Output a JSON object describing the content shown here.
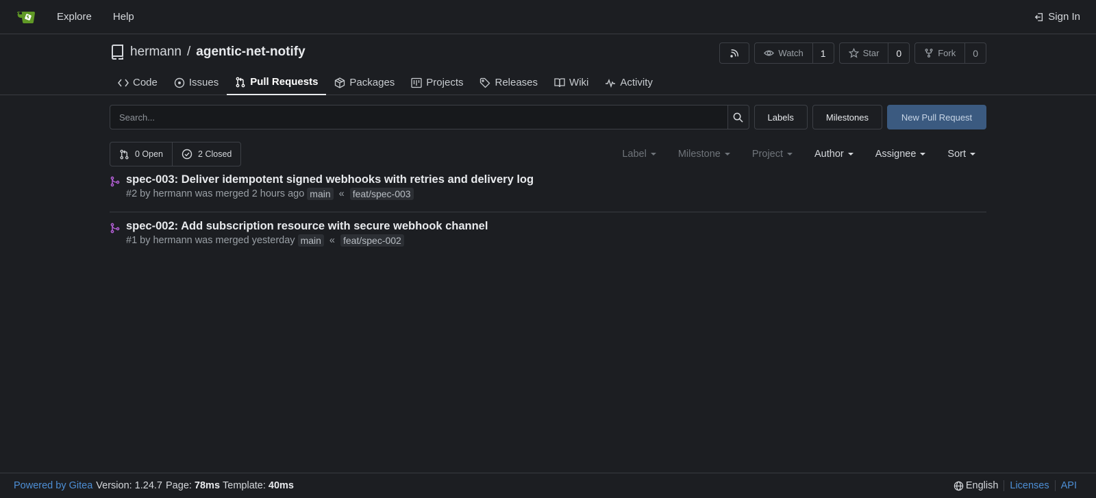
{
  "navbar": {
    "explore": "Explore",
    "help": "Help",
    "sign_in": "Sign In"
  },
  "repo": {
    "owner": "hermann",
    "separator": "/",
    "name": "agentic-net-notify",
    "watch_label": "Watch",
    "watch_count": "1",
    "star_label": "Star",
    "star_count": "0",
    "fork_label": "Fork",
    "fork_count": "0"
  },
  "tabs": [
    {
      "label": "Code",
      "icon": "code-icon"
    },
    {
      "label": "Issues",
      "icon": "issue-icon"
    },
    {
      "label": "Pull Requests",
      "icon": "pull-request-icon",
      "active": true
    },
    {
      "label": "Packages",
      "icon": "package-icon"
    },
    {
      "label": "Projects",
      "icon": "project-icon"
    },
    {
      "label": "Releases",
      "icon": "tag-icon"
    },
    {
      "label": "Wiki",
      "icon": "book-icon"
    },
    {
      "label": "Activity",
      "icon": "pulse-icon"
    }
  ],
  "toolbar": {
    "search_placeholder": "Search...",
    "labels": "Labels",
    "milestones": "Milestones",
    "new_pr": "New Pull Request"
  },
  "filters": {
    "open": "0 Open",
    "closed": "2 Closed",
    "label": "Label",
    "milestone": "Milestone",
    "project": "Project",
    "author": "Author",
    "assignee": "Assignee",
    "sort": "Sort"
  },
  "pull_requests": [
    {
      "title": "spec-003: Deliver idempotent signed webhooks with retries and delivery log",
      "number": "#2",
      "by": "by",
      "author": "hermann",
      "status": "was merged",
      "time": "2 hours ago",
      "target": "main",
      "source": "feat/spec-003"
    },
    {
      "title": "spec-002: Add subscription resource with secure webhook channel",
      "number": "#1",
      "by": "by",
      "author": "hermann",
      "status": "was merged",
      "time": "yesterday",
      "target": "main",
      "source": "feat/spec-002"
    }
  ],
  "footer": {
    "powered_by": "Powered by Gitea",
    "version_label": "Version: 1.24.7",
    "page_label": "Page:",
    "page_time": "78ms",
    "template_label": "Template:",
    "template_time": "40ms",
    "language": "English",
    "licenses": "Licenses",
    "api": "API"
  },
  "colors": {
    "background": "#1c1e22",
    "primary_button": "#3b5a80",
    "merged_icon": "#b45fd6",
    "link": "#4d8fd6",
    "logo": "#609926"
  }
}
